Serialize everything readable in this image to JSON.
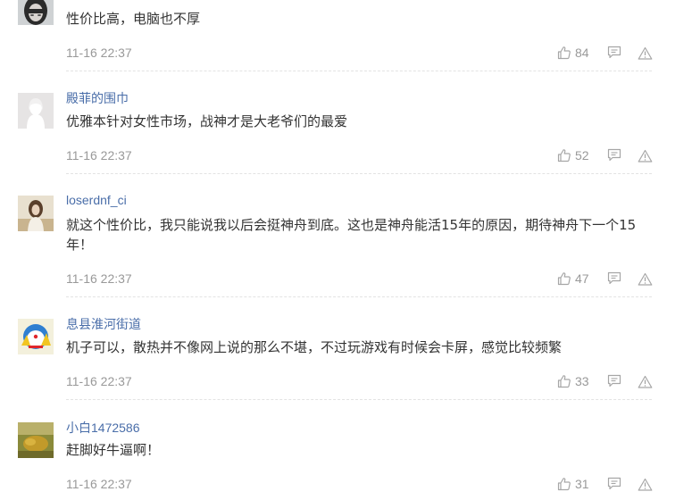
{
  "comments": [
    {
      "username": "",
      "text": "性价比高，电脑也不厚",
      "time": "11-16 22:37",
      "likes": "84",
      "avatar": "avatar-dark-hair"
    },
    {
      "username": "殿菲的围巾",
      "text": "优雅本针对女性市场，战神才是大老爷们的最爱",
      "time": "11-16 22:37",
      "likes": "52",
      "avatar": "avatar-default"
    },
    {
      "username": "loserdnf_ci",
      "text": "就这个性价比，我只能说我以后会挺神舟到底。这也是神舟能活15年的原因，期待神舟下一个15年！",
      "time": "11-16 22:37",
      "likes": "47",
      "avatar": "avatar-girl-photo"
    },
    {
      "username": "息县淮河街道",
      "text": "机子可以，散热并不像网上说的那么不堪，不过玩游戏有时候会卡屏，感觉比较频繁",
      "time": "11-16 22:37",
      "likes": "33",
      "avatar": "avatar-cartoon"
    },
    {
      "username": "小白1472586",
      "text": "赶脚好牛逼啊！",
      "time": "11-16 22:37",
      "likes": "31",
      "avatar": "avatar-landscape"
    }
  ],
  "colors": {
    "username": "#4a6ea9",
    "text": "#333333",
    "meta": "#999999",
    "icon": "#a6a6a6"
  }
}
